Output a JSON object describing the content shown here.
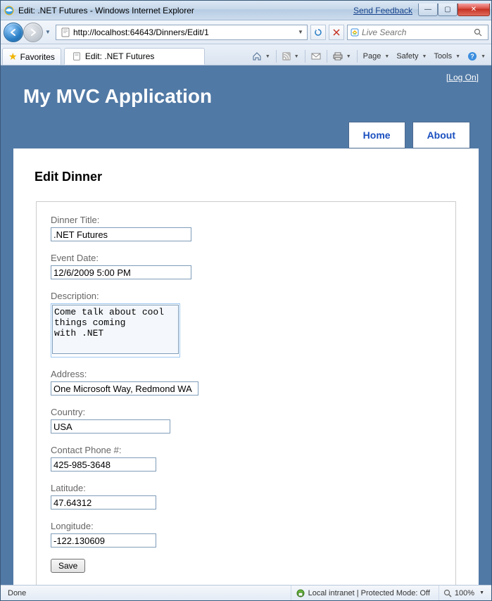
{
  "window": {
    "title": "Edit: .NET Futures - Windows Internet Explorer",
    "feedback": "Send Feedback"
  },
  "nav": {
    "url": "http://localhost:64643/Dinners/Edit/1",
    "refresh_tip": "Refresh",
    "stop_tip": "Stop",
    "search_placeholder": "Live Search"
  },
  "tabs": {
    "favorites": "Favorites",
    "active": "Edit: .NET Futures"
  },
  "cmd": {
    "page": "Page",
    "safety": "Safety",
    "tools": "Tools"
  },
  "app": {
    "logon": "Log On",
    "title": "My MVC Application",
    "nav_home": "Home",
    "nav_about": "About"
  },
  "form": {
    "heading": "Edit Dinner",
    "labels": {
      "title": "Dinner Title:",
      "date": "Event Date:",
      "description": "Description:",
      "address": "Address:",
      "country": "Country:",
      "phone": "Contact Phone #:",
      "lat": "Latitude:",
      "lon": "Longitude:"
    },
    "values": {
      "title": ".NET Futures",
      "date": "12/6/2009 5:00 PM",
      "description": "Come talk about cool things coming\nwith .NET",
      "address": "One Microsoft Way, Redmond WA",
      "country": "USA",
      "phone": "425-985-3648",
      "lat": "47.64312",
      "lon": "-122.130609"
    },
    "save": "Save"
  },
  "status": {
    "done": "Done",
    "zone": "Local intranet | Protected Mode: Off",
    "zoom": "100%"
  }
}
